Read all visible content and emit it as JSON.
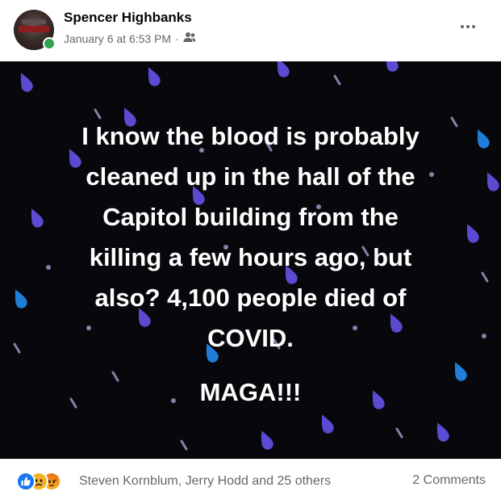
{
  "post": {
    "author": "Spencer Highbanks",
    "timestamp": "January 6 at 6:53 PM",
    "separator": "·",
    "audience_icon": "friends-icon",
    "more_icon": "more-options-icon"
  },
  "image": {
    "background_color": "#07070c",
    "drop_colors": [
      "#5a4bd1",
      "#1f7fd6",
      "#8a7fa8"
    ],
    "line1": "I know the blood is probably",
    "line2": "cleaned up in the hall of the",
    "line3": "Capitol building from the",
    "line4": "killing a few hours ago, but",
    "line5": "also? 4,100 people died of",
    "line6": "COVID.",
    "line7": "MAGA!!!"
  },
  "footer": {
    "reaction_icons": [
      "like-icon",
      "sad-icon",
      "angry-icon"
    ],
    "reaction_names": "Steven Kornblum, Jerry Hodd and 25 others",
    "comments": "2 Comments"
  }
}
